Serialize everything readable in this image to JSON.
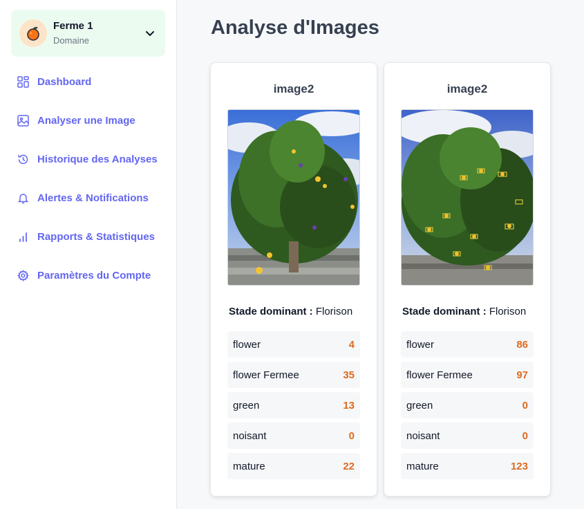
{
  "sidebar": {
    "farm": {
      "name": "Ferme 1",
      "subtitle": "Domaine"
    },
    "items": [
      {
        "label": "Dashboard",
        "icon": "dashboard-icon"
      },
      {
        "label": "Analyser une Image",
        "icon": "image-icon"
      },
      {
        "label": "Historique des Analyses",
        "icon": "history-icon"
      },
      {
        "label": "Alertes & Notifications",
        "icon": "bell-icon"
      },
      {
        "label": "Rapports & Statistiques",
        "icon": "bar-chart-icon"
      },
      {
        "label": "Paramètres du Compte",
        "icon": "gear-icon"
      }
    ]
  },
  "main": {
    "title": "Analyse d'Images",
    "cards": [
      {
        "title": "image2",
        "stage_label": "Stade dominant :",
        "stage_value": "Florison",
        "stats": [
          {
            "label": "flower",
            "value": "4"
          },
          {
            "label": "flower Fermee",
            "value": "35"
          },
          {
            "label": "green",
            "value": "13"
          },
          {
            "label": "noisant",
            "value": "0"
          },
          {
            "label": "mature",
            "value": "22"
          }
        ]
      },
      {
        "title": "image2",
        "stage_label": "Stade dominant :",
        "stage_value": "Florison",
        "stats": [
          {
            "label": "flower",
            "value": "86"
          },
          {
            "label": "flower Fermee",
            "value": "97"
          },
          {
            "label": "green",
            "value": "0"
          },
          {
            "label": "noisant",
            "value": "0"
          },
          {
            "label": "mature",
            "value": "123"
          }
        ]
      }
    ]
  },
  "colors": {
    "accent": "#6366f1",
    "count": "#dd6b20",
    "farm_bg": "#ecfbf0"
  }
}
